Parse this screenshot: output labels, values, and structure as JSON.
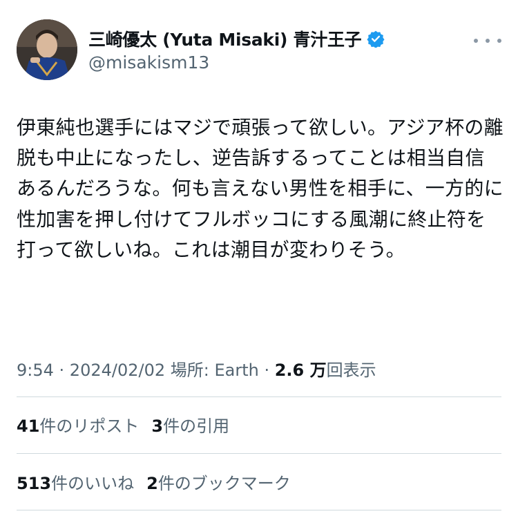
{
  "author": {
    "display_name": "三崎優太 (Yuta Misaki) 青汁王子",
    "handle": "@misakism13",
    "verified": true,
    "verified_color": "#1d9bf0"
  },
  "tweet": {
    "text": "伊東純也選手にはマジで頑張って欲しい。アジア杯の離脱も中止になったし、逆告訴するってことは相当自信あるんだろうな。何も言えない男性を相手に、一方的に性加害を押し付けてフルボッコにする風潮に終止符を打って欲しいね。これは潮目が変わりそう。"
  },
  "meta": {
    "time": "9:54",
    "sep1": " · ",
    "date": "2024/02/02",
    "location": " 場所: Earth",
    "sep2": " · ",
    "views_count": "2.6 万",
    "views_label": "回表示"
  },
  "stats": {
    "reposts_count": "41",
    "reposts_label": "件のリポスト",
    "quotes_count": "3",
    "quotes_label": "件の引用",
    "likes_count": "513",
    "likes_label": "件のいいね",
    "bookmarks_count": "2",
    "bookmarks_label": "件のブックマーク"
  },
  "icons": {
    "more": "more-options-icon",
    "verified": "verified-badge-icon"
  },
  "colors": {
    "text_primary": "#0f1419",
    "text_secondary": "#536471",
    "divider": "#cfd9de"
  }
}
